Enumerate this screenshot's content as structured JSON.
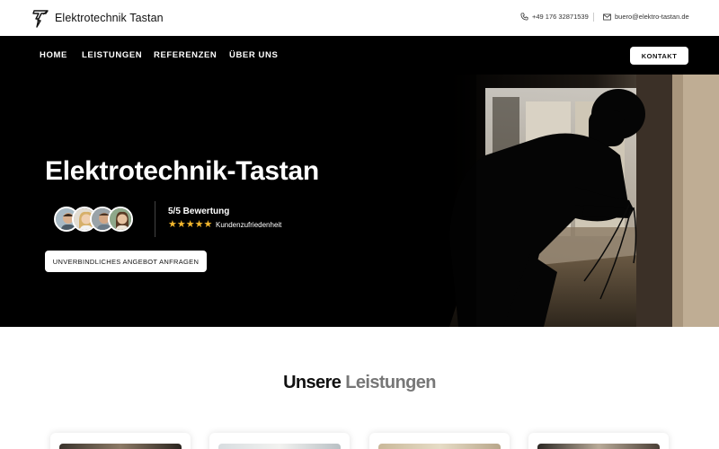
{
  "brand": {
    "name": "Elektrotechnik Tastan",
    "logo_icon": "lightning-t-logo"
  },
  "contact": {
    "phone": "+49 176 32871539",
    "email": "buero@elektro-tastan.de",
    "phone_icon": "phone-icon",
    "email_icon": "envelope-icon"
  },
  "nav": {
    "items": [
      {
        "label": "HOME"
      },
      {
        "label": "LEISTUNGEN"
      },
      {
        "label": "REFERENZEN"
      },
      {
        "label": "ÜBER UNS"
      }
    ],
    "contact_button": "KONTAKT"
  },
  "hero": {
    "title": "Elektrotechnik-Tastan",
    "rating_title": "5/5 Bewertung",
    "rating_stars": 5,
    "rating_subtitle": "Kundenzufriedenheit",
    "cta": "UNVERBINDLICHES ANGEBOT ANFRAGEN"
  },
  "services": {
    "title_part1": "Unsere",
    "title_part2": "Leistungen"
  },
  "colors": {
    "nav_bg": "#000000",
    "star": "#f5b82e",
    "accent_text": "#777777"
  }
}
